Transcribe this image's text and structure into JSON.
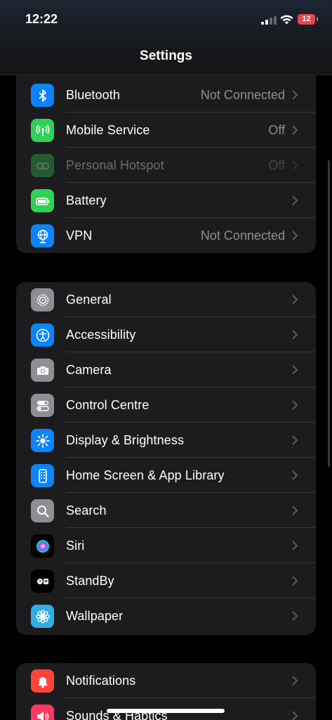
{
  "status_bar": {
    "time": "12:22",
    "battery_level": "12"
  },
  "nav": {
    "title": "Settings"
  },
  "group1": [
    {
      "label": "Bluetooth",
      "value": "Not Connected",
      "icon": "bluetooth-icon",
      "color": "#0a84ff"
    },
    {
      "label": "Mobile Service",
      "value": "Off",
      "icon": "antenna-icon",
      "color": "#30d158"
    },
    {
      "label": "Personal Hotspot",
      "value": "Off",
      "icon": "hotspot-icon",
      "color": "#30d158",
      "disabled": true
    },
    {
      "label": "Battery",
      "value": "",
      "icon": "battery-icon",
      "color": "#30d158"
    },
    {
      "label": "VPN",
      "value": "Not Connected",
      "icon": "globe-icon",
      "color": "#0a84ff"
    }
  ],
  "group2": [
    {
      "label": "General",
      "icon": "gear-icon",
      "color": "#8e8e93"
    },
    {
      "label": "Accessibility",
      "icon": "accessibility-icon",
      "color": "#0a84ff"
    },
    {
      "label": "Camera",
      "icon": "camera-icon",
      "color": "#8e8e93"
    },
    {
      "label": "Control Centre",
      "icon": "toggles-icon",
      "color": "#8e8e93"
    },
    {
      "label": "Display & Brightness",
      "icon": "sun-icon",
      "color": "#0a84ff"
    },
    {
      "label": "Home Screen & App Library",
      "icon": "phone-grid-icon",
      "color": "#0a84ff"
    },
    {
      "label": "Search",
      "icon": "magnifier-icon",
      "color": "#8e8e93"
    },
    {
      "label": "Siri",
      "icon": "siri-icon",
      "color": "#000000"
    },
    {
      "label": "StandBy",
      "icon": "standby-icon",
      "color": "#000000"
    },
    {
      "label": "Wallpaper",
      "icon": "flower-icon",
      "color": "#32ade6"
    }
  ],
  "group3": [
    {
      "label": "Notifications",
      "icon": "bell-icon",
      "color": "#ff453a"
    },
    {
      "label": "Sounds & Haptics",
      "icon": "speaker-icon",
      "color": "#ff375f"
    }
  ]
}
